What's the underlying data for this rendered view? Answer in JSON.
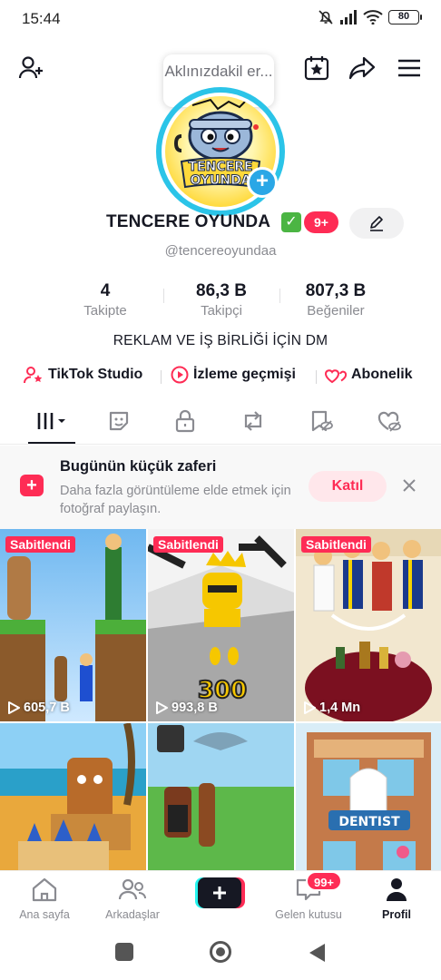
{
  "status_bar": {
    "time": "15:44",
    "battery": "80"
  },
  "header": {
    "tooltip": "Aklınızdakil er..."
  },
  "profile": {
    "name": "TENCERE OYUNDA",
    "verified_emoji": "✓",
    "badge": "9+",
    "handle": "@tencereoyundaa",
    "avatar_text_line1": "TENCERE",
    "avatar_text_line2": "OYUNDA"
  },
  "stats": [
    {
      "value": "4",
      "label": "Takipte"
    },
    {
      "value": "86,3 B",
      "label": "Takipçi"
    },
    {
      "value": "807,3 B",
      "label": "Beğeniler"
    }
  ],
  "bio": "REKLAM VE İŞ BİRLİĞİ İÇİN DM",
  "links": [
    {
      "label": "TikTok Studio"
    },
    {
      "label": "İzleme geçmişi"
    },
    {
      "label": "Abonelik"
    }
  ],
  "promo": {
    "title": "Bugünün küçük zaferi",
    "description": "Daha fazla görüntüleme elde etmek için fotoğraf paylaşın.",
    "join_label": "Katıl"
  },
  "videos": [
    {
      "pinned": "Sabitlendi",
      "views": "605,7 B"
    },
    {
      "pinned": "Sabitlendi",
      "views": "993,8 B",
      "overlay_number": "300"
    },
    {
      "pinned": "Sabitlendi",
      "views": "1,4 Mn"
    },
    {
      "pinned": "",
      "views": ""
    },
    {
      "pinned": "",
      "views": ""
    },
    {
      "pinned": "",
      "views": "",
      "sign_text": "DENTIST"
    }
  ],
  "bottom_nav": {
    "home": "Ana sayfa",
    "friends": "Arkadaşlar",
    "inbox": "Gelen kutusu",
    "inbox_badge": "99+",
    "profile": "Profil"
  },
  "colors": {
    "accent": "#fe2c55",
    "ring": "#2bc4e8",
    "text": "#161823",
    "muted": "#8a8b91"
  }
}
